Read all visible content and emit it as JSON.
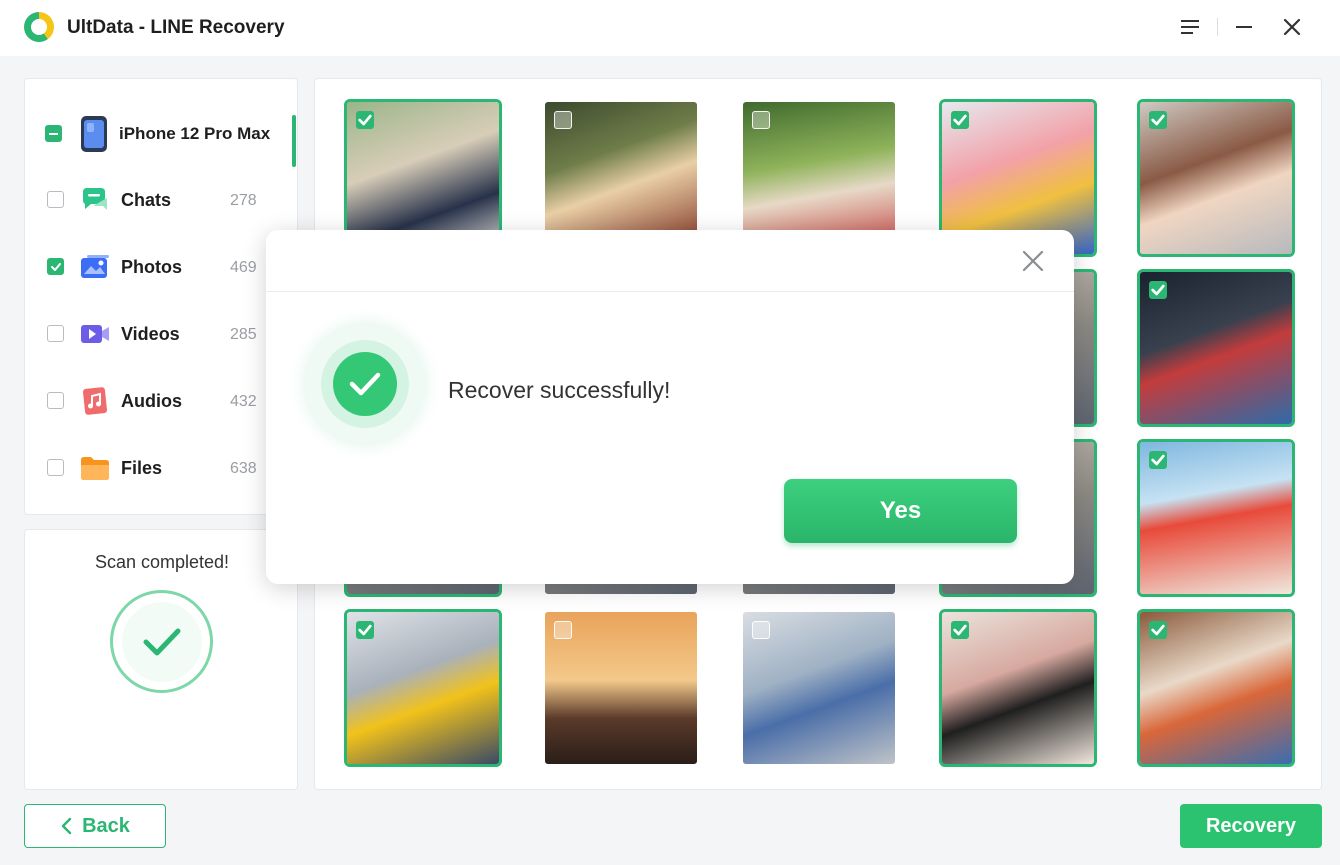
{
  "app": {
    "title": "UltData - LINE Recovery",
    "icons": {
      "menu": "menu-icon",
      "minimize": "minimize-icon",
      "close": "close-icon"
    }
  },
  "sidebar": {
    "device": {
      "name": "iPhone 12 Pro Max",
      "state": "partial"
    },
    "categories": [
      {
        "label": "Chats",
        "count": "278",
        "checked": false,
        "icon": "chats-icon",
        "color": "#2bc48a"
      },
      {
        "label": "Photos",
        "count": "469",
        "checked": true,
        "icon": "photos-icon",
        "color": "#3b6ef5"
      },
      {
        "label": "Videos",
        "count": "285",
        "checked": false,
        "icon": "videos-icon",
        "color": "#6c5ce7"
      },
      {
        "label": "Audios",
        "count": "432",
        "checked": false,
        "icon": "audios-icon",
        "color": "#f06b6b"
      },
      {
        "label": "Files",
        "count": "638",
        "checked": false,
        "icon": "files-icon",
        "color": "#f7941d"
      }
    ]
  },
  "scan": {
    "status": "Scan completed!"
  },
  "photos": [
    {
      "subject": "wedding-couple",
      "selected": true
    },
    {
      "subject": "woman-with-cup",
      "selected": false
    },
    {
      "subject": "children-in-park",
      "selected": false
    },
    {
      "subject": "party-crowd",
      "selected": true
    },
    {
      "subject": "child-drumming",
      "selected": true
    },
    {
      "subject": "photo-hidden-1",
      "selected": true
    },
    {
      "subject": "photo-hidden-2",
      "selected": false
    },
    {
      "subject": "photo-hidden-3",
      "selected": false
    },
    {
      "subject": "photo-hidden-4",
      "selected": true
    },
    {
      "subject": "dj-turntables",
      "selected": true
    },
    {
      "subject": "photo-hidden-5",
      "selected": true
    },
    {
      "subject": "photo-hidden-6",
      "selected": false
    },
    {
      "subject": "photo-hidden-7",
      "selected": false
    },
    {
      "subject": "photo-hidden-8",
      "selected": true
    },
    {
      "subject": "beach-boat",
      "selected": true
    },
    {
      "subject": "street-friends",
      "selected": true
    },
    {
      "subject": "sunset-woman",
      "selected": false
    },
    {
      "subject": "skateboarder",
      "selected": false
    },
    {
      "subject": "girl-piano",
      "selected": true
    },
    {
      "subject": "mother-daughter",
      "selected": true
    }
  ],
  "buttons": {
    "back": "Back",
    "recovery": "Recovery"
  },
  "dialog": {
    "message": "Recover successfully!",
    "confirm": "Yes"
  },
  "colors": {
    "accent": "#2bb673"
  }
}
